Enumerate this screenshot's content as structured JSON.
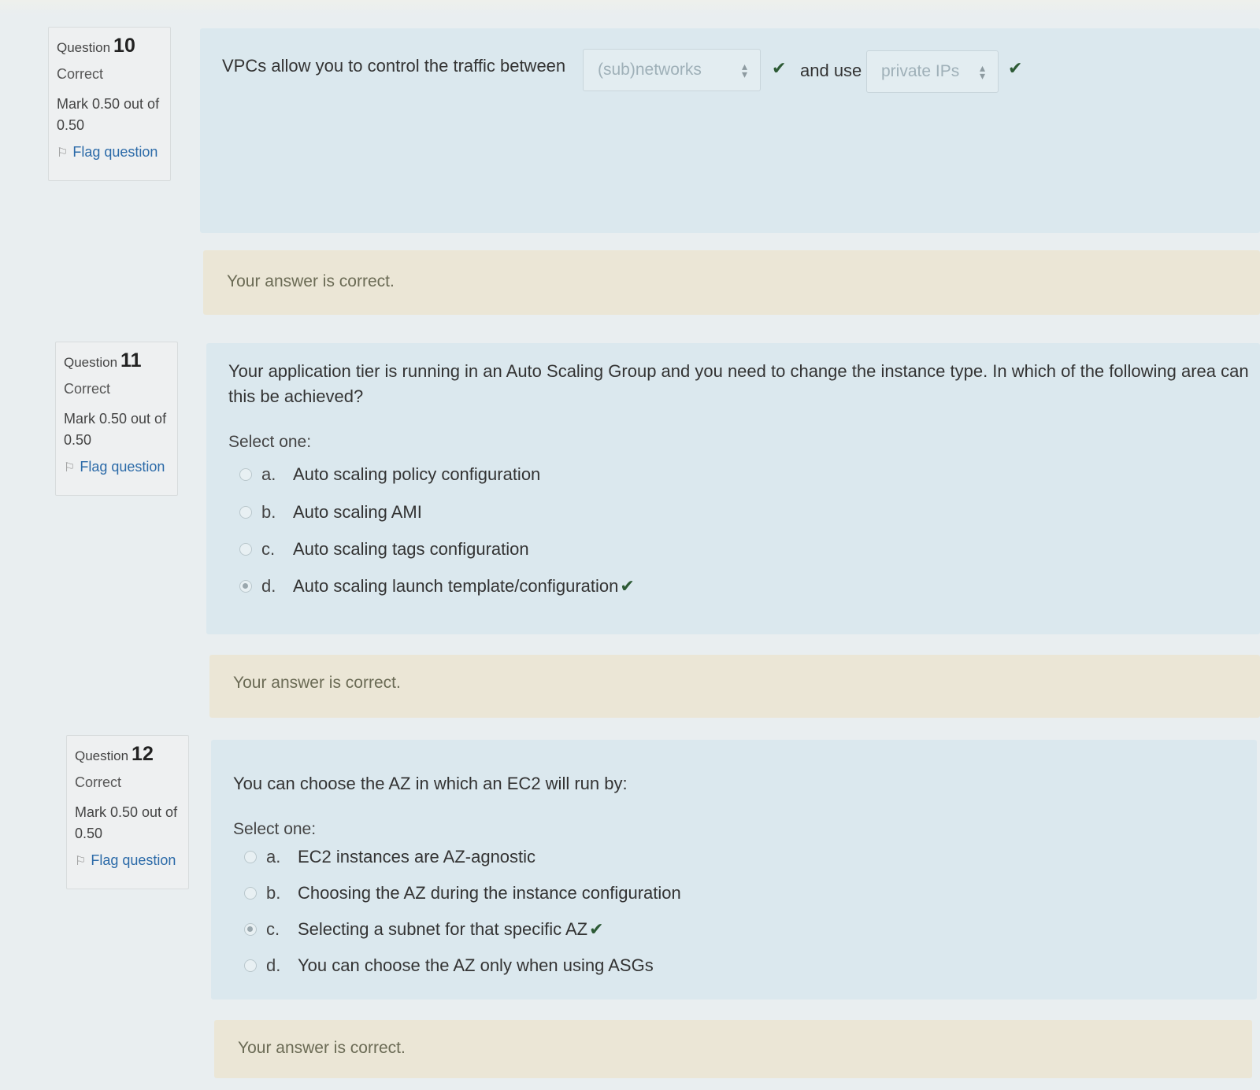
{
  "questions": [
    {
      "info": {
        "label": "Question",
        "number": "10",
        "state": "Correct",
        "grade": "Mark 0.50 out of 0.50",
        "flag": "Flag question"
      },
      "text_before": "VPCs allow you to control the traffic between",
      "select1": "(sub)networks",
      "text_mid": "and use",
      "select2": "private IPs",
      "feedback": "Your answer is correct."
    },
    {
      "info": {
        "label": "Question",
        "number": "11",
        "state": "Correct",
        "grade": "Mark 0.50 out of 0.50",
        "flag": "Flag question"
      },
      "text": "Your application tier is running in an Auto Scaling Group and you need to change the instance type. In which of the following area can this be achieved?",
      "select_one": "Select one:",
      "options": [
        {
          "letter": "a.",
          "text": "Auto scaling policy configuration"
        },
        {
          "letter": "b.",
          "text": "Auto scaling AMI"
        },
        {
          "letter": "c.",
          "text": "Auto scaling tags configuration"
        },
        {
          "letter": "d.",
          "text": "Auto scaling launch template/configuration"
        }
      ],
      "selected": "d.",
      "feedback": "Your answer is correct."
    },
    {
      "info": {
        "label": "Question",
        "number": "12",
        "state": "Correct",
        "grade": "Mark 0.50 out of 0.50",
        "flag": "Flag question"
      },
      "text": "You can choose the AZ in which an EC2 will run by:",
      "select_one": "Select one:",
      "options": [
        {
          "letter": "a.",
          "text": "EC2 instances are AZ-agnostic"
        },
        {
          "letter": "b.",
          "text": "Choosing the AZ during the instance configuration"
        },
        {
          "letter": "c.",
          "text": "Selecting a subnet for that specific AZ"
        },
        {
          "letter": "d.",
          "text": "You can choose the AZ only when using ASGs"
        }
      ],
      "selected": "c.",
      "feedback": "Your answer is correct."
    }
  ],
  "colors": {
    "info_bg": "#eef0f1",
    "formulation_bg": "#dbe8ee",
    "feedback_bg": "#ebe6d6",
    "flag_link": "#2b6aa8",
    "tick": "#2d5a35"
  }
}
